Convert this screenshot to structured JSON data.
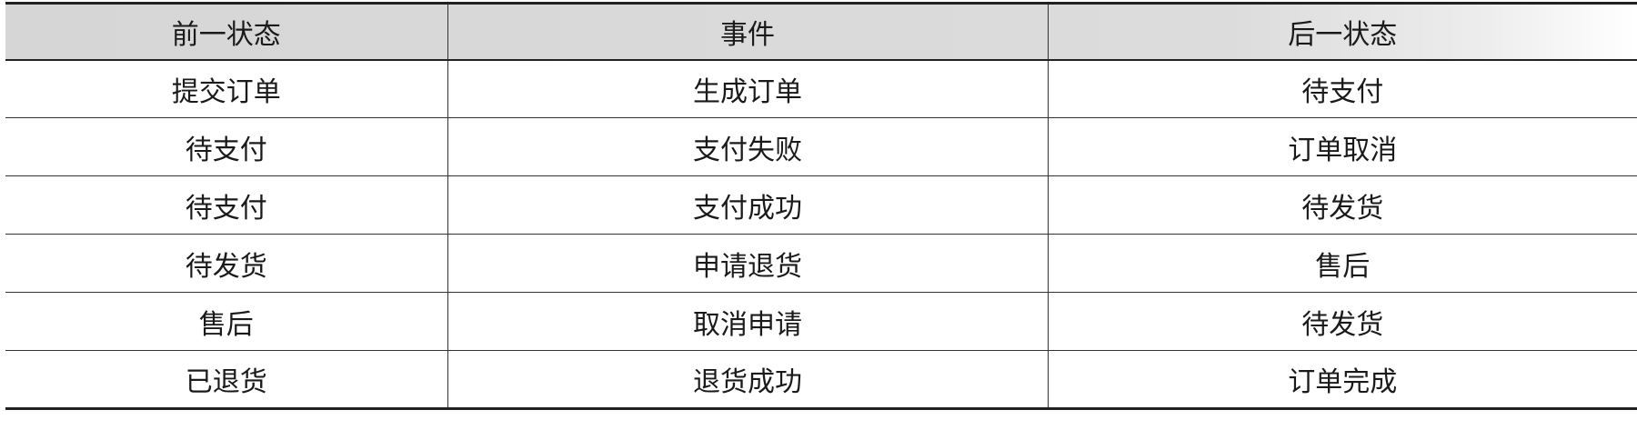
{
  "table": {
    "headers": [
      "前一状态",
      "事件",
      "后一状态"
    ],
    "rows": [
      [
        "提交订单",
        "生成订单",
        "待支付"
      ],
      [
        "待支付",
        "支付失败",
        "订单取消"
      ],
      [
        "待支付",
        "支付成功",
        "待发货"
      ],
      [
        "待发货",
        "申请退货",
        "售后"
      ],
      [
        "售后",
        "取消申请",
        "待发货"
      ],
      [
        "已退货",
        "退货成功",
        "订单完成"
      ]
    ]
  }
}
